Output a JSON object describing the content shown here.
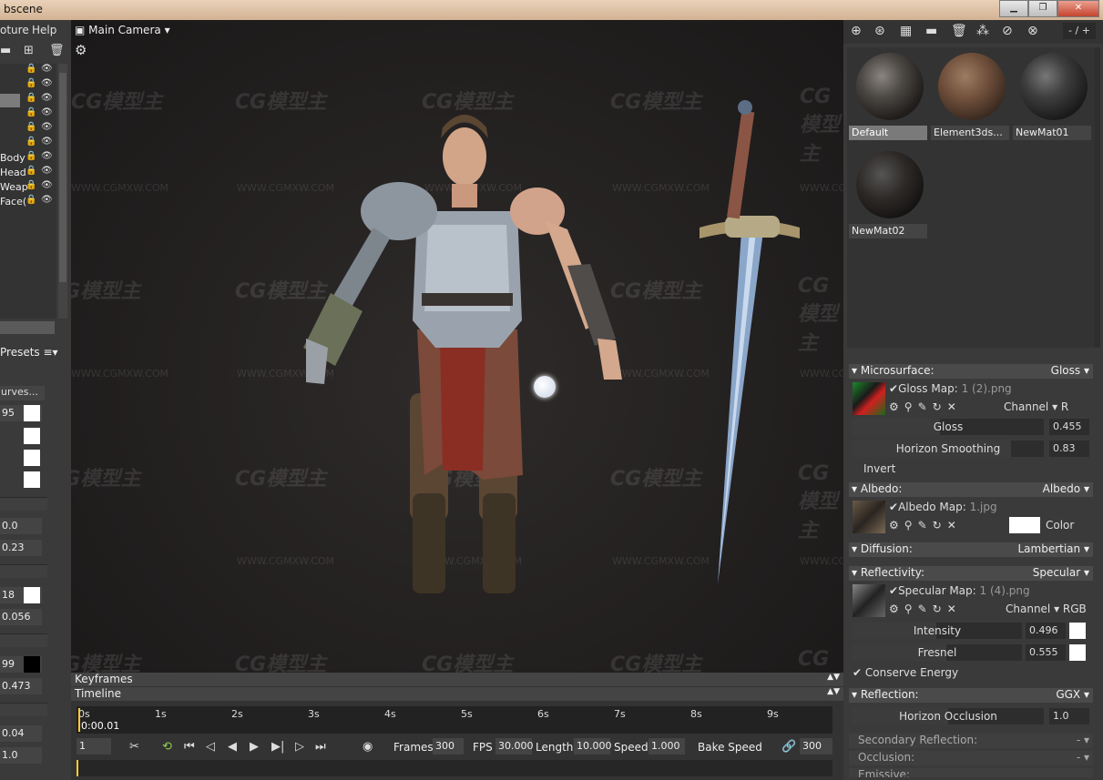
{
  "window": {
    "title": "bscene",
    "minimize": "▁",
    "maximize": "❐",
    "close": "✕"
  },
  "menu": {
    "items": [
      "oture",
      "Help"
    ]
  },
  "scene": {
    "rows": [
      {
        "label": ""
      },
      {
        "label": ""
      },
      {
        "label": ""
      },
      {
        "label": ""
      },
      {
        "label": ""
      },
      {
        "label": ""
      },
      {
        "label": "Body"
      },
      {
        "label": "Head"
      },
      {
        "label": "Weap"
      },
      {
        "label": "Face("
      }
    ]
  },
  "left": {
    "presets": "Presets ≡▾",
    "curves": "urves...",
    "fields": [
      "95",
      "0.0",
      "0.23",
      "18",
      "0.056",
      "99",
      "0.473",
      "0.04",
      "1.0"
    ]
  },
  "viewport": {
    "camera": "Main Camera",
    "watermark": "CG模型主",
    "watermark_url": "WWW.CGMXW.COM"
  },
  "timeline": {
    "keyframes_label": "Keyframes",
    "timeline_label": "Timeline",
    "ticks": [
      "0s",
      "1s",
      "2s",
      "3s",
      "4s",
      "5s",
      "6s",
      "7s",
      "8s",
      "9s"
    ],
    "current_time": "0:00.01",
    "frame_field": "1",
    "frames_label": "Frames",
    "frames_value": "300",
    "fps_label": "FPS",
    "fps_value": "30.000",
    "length_label": "Length",
    "length_value": "10.000",
    "speed_label": "Speed",
    "speed_value": "1.000",
    "bake_speed_label": "Bake Speed",
    "bake_value": "300"
  },
  "materials": {
    "page": "- / +",
    "items": [
      {
        "name": "Default"
      },
      {
        "name": "Element3ds..."
      },
      {
        "name": "NewMat01"
      },
      {
        "name": "NewMat02"
      }
    ]
  },
  "props": {
    "microsurface": {
      "title": "Microsurface:",
      "mode": "Gloss",
      "map_label": "Gloss Map:",
      "map_file": "1 (2).png",
      "channel_label": "Channel",
      "channel_value": "R",
      "gloss_label": "Gloss",
      "gloss_value": "0.455",
      "horizon_label": "Horizon Smoothing",
      "horizon_value": "0.83",
      "invert_label": "Invert",
      "gloss_level": 0.455,
      "horizon_level": 0.83
    },
    "albedo": {
      "title": "Albedo:",
      "mode": "Albedo",
      "map_label": "Albedo Map:",
      "map_file": "1.jpg",
      "color_label": "Color"
    },
    "diffusion": {
      "title": "Diffusion:",
      "mode": "Lambertian"
    },
    "reflectivity": {
      "title": "Reflectivity:",
      "mode": "Specular",
      "map_label": "Specular Map:",
      "map_file": "1 (4).png",
      "channel_label": "Channel",
      "channel_value": "RGB",
      "intensity_label": "Intensity",
      "intensity_value": "0.496",
      "fresnel_label": "Fresnel",
      "fresnel_value": "0.555",
      "conserve_label": "Conserve Energy",
      "intensity_level": 0.496,
      "fresnel_level": 0.555
    },
    "reflection": {
      "title": "Reflection:",
      "mode": "GGX",
      "horizon_label": "Horizon Occlusion",
      "horizon_value": "1.0",
      "horizon_level": 0.5
    },
    "secondary": {
      "title": "Secondary Reflection:",
      "mode": "-"
    },
    "occlusion": {
      "title": "Occlusion:",
      "mode": "-"
    },
    "emissive": {
      "title": "Emissive:"
    }
  },
  "colors": {
    "panel": "#3a3a3a",
    "viewport": "#221f1f",
    "accent": "#ffcc33"
  }
}
